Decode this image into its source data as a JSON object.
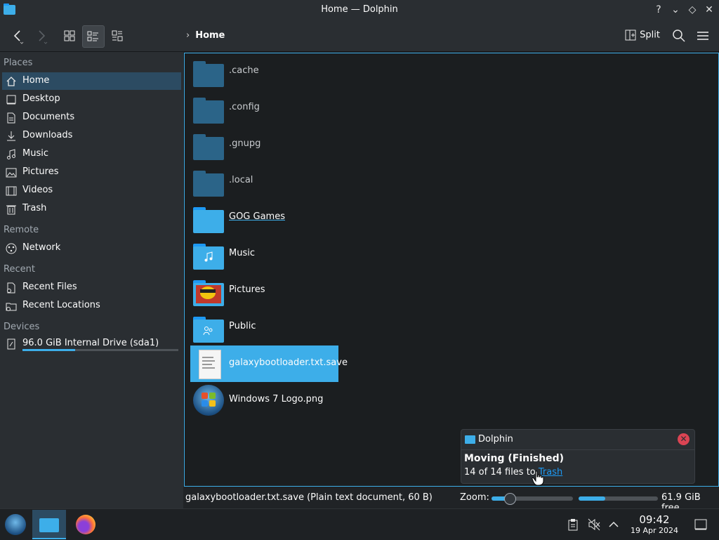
{
  "window": {
    "title": "Home — Dolphin"
  },
  "toolbar": {
    "breadcrumb": "Home",
    "split_label": "Split"
  },
  "sidebar": {
    "sections": [
      {
        "title": "Places",
        "items": [
          "Home",
          "Desktop",
          "Documents",
          "Downloads",
          "Music",
          "Pictures",
          "Videos",
          "Trash"
        ]
      },
      {
        "title": "Remote",
        "items": [
          "Network"
        ]
      },
      {
        "title": "Recent",
        "items": [
          "Recent Files",
          "Recent Locations"
        ]
      },
      {
        "title": "Devices",
        "items": [
          "96.0 GiB Internal Drive (sda1)"
        ]
      }
    ],
    "selected": "Home",
    "drive_usage_fraction": 0.34
  },
  "files": [
    {
      "name": ".cache",
      "type": "folder",
      "hidden": true
    },
    {
      "name": ".config",
      "type": "folder",
      "hidden": true
    },
    {
      "name": ".gnupg",
      "type": "folder",
      "hidden": true
    },
    {
      "name": ".local",
      "type": "folder",
      "hidden": true
    },
    {
      "name": "GOG Games",
      "type": "folder",
      "hovered": true
    },
    {
      "name": "Music",
      "type": "folder-music"
    },
    {
      "name": "Pictures",
      "type": "folder-pictures"
    },
    {
      "name": "Public",
      "type": "folder-public"
    },
    {
      "name": "galaxybootloader.txt.save",
      "type": "text-file",
      "selected": true
    },
    {
      "name": "Windows 7 Logo.png",
      "type": "image"
    }
  ],
  "notification": {
    "app": "Dolphin",
    "title": "Moving (Finished)",
    "body_prefix": "14 of 14 files to ",
    "link": "Trash"
  },
  "statusbar": {
    "info": "galaxybootloader.txt.save (Plain text document, 60 B)",
    "zoom_label": "Zoom:",
    "zoom_fraction": 0.22,
    "free_space": "61.9 GiB free",
    "used_fraction": 0.34
  },
  "taskbar": {
    "time": "09:42",
    "date": "19 Apr 2024"
  },
  "colors": {
    "accent": "#3daee9",
    "selection": "#2c4b62",
    "close_red": "#da4453"
  }
}
